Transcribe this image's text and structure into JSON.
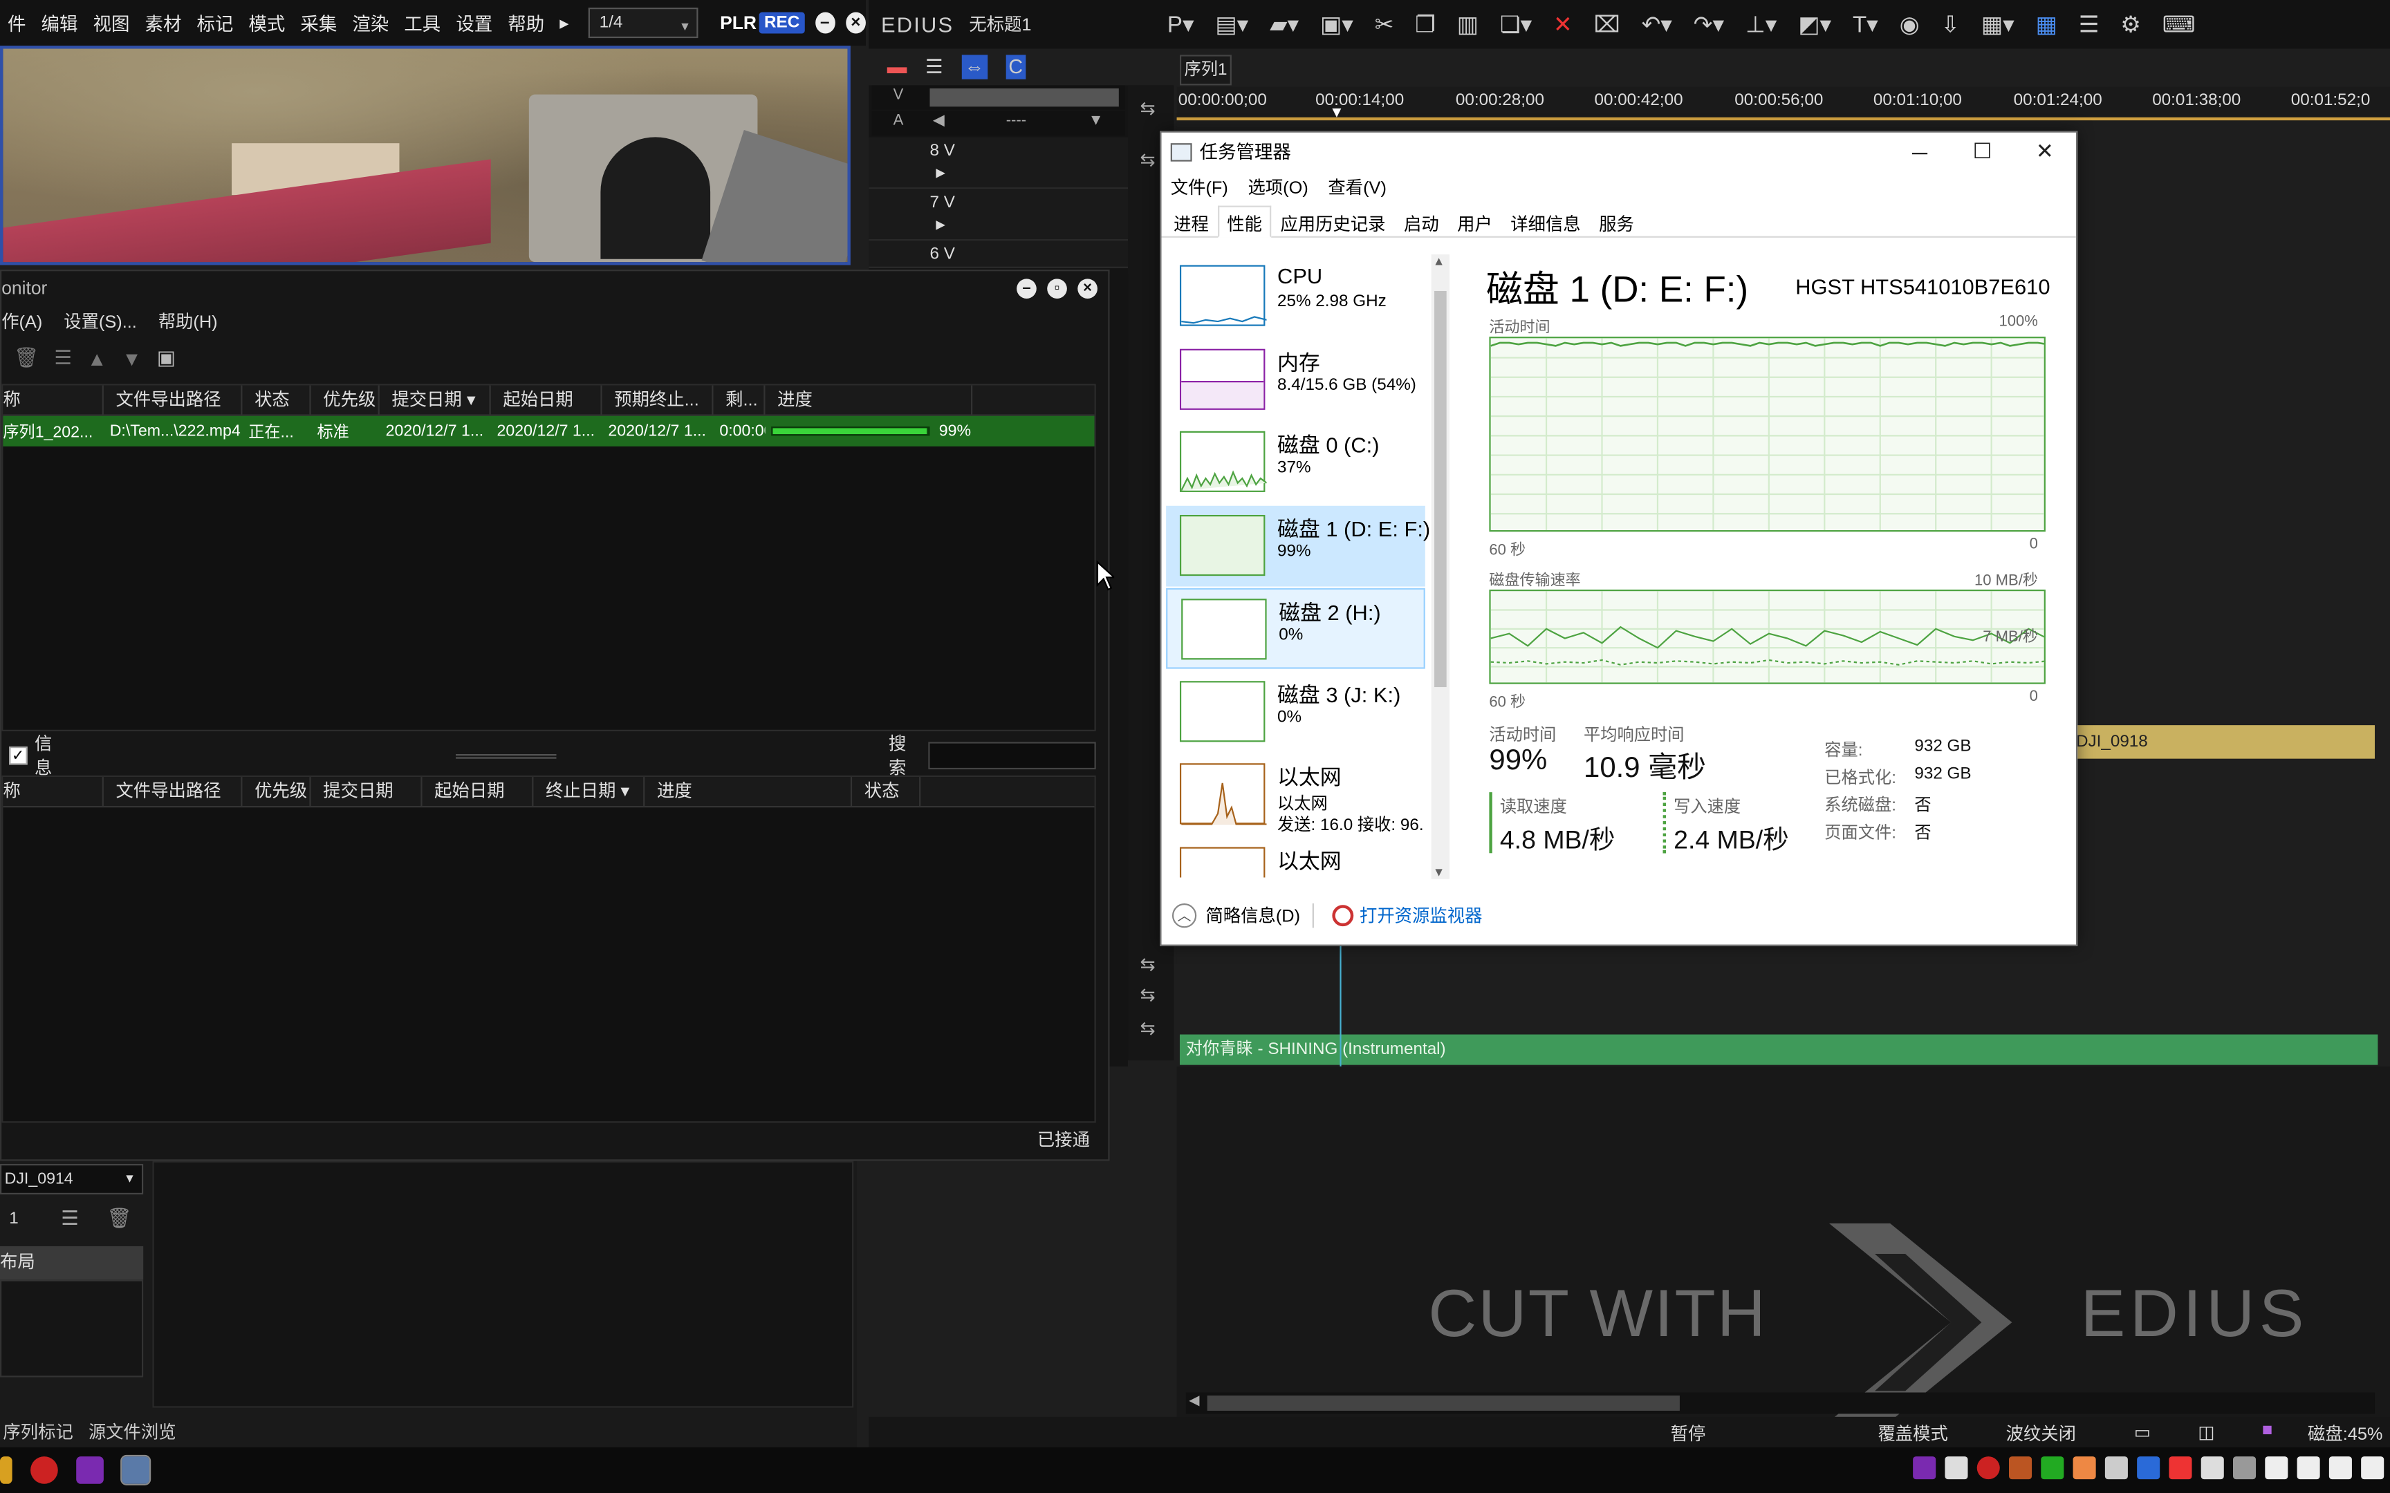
{
  "menubar": {
    "items": [
      "件",
      "编辑",
      "视图",
      "素材",
      "标记",
      "模式",
      "采集",
      "渲染",
      "工具",
      "设置",
      "帮助"
    ],
    "more": "▸",
    "page": "1/4",
    "plr": "PLR",
    "rec": "REC"
  },
  "monitor": {
    "title": "onitor",
    "menu": [
      "作(A)",
      "设置(S)...",
      "帮助(H)"
    ],
    "queue_headers": [
      "称",
      "文件导出路径",
      "状态",
      "优先级",
      "提交日期",
      "起始日期",
      "预期终止...",
      "剩...",
      "进度"
    ],
    "queue_row": {
      "name": "序列1_202...",
      "path": "D:\\Tem...\\222.mp4",
      "status": "正在...",
      "priority": "标准",
      "submit": "2020/12/7 1...",
      "start": "2020/12/7 1...",
      "end": "2020/12/7 1...",
      "remaining": "0:00:00",
      "progress_pct": 99,
      "progress_text": "99%"
    },
    "info_label": "信息",
    "search_label": "搜索",
    "done_headers": [
      "称",
      "文件导出路径",
      "优先级",
      "提交日期",
      "起始日期",
      "终止日期",
      "进度",
      "状态"
    ],
    "status_text": "已接通"
  },
  "edius": {
    "logo": "EDIUS",
    "project": "无标题1",
    "sequence_tab": "序列1",
    "timecodes": [
      "00:00:00;00",
      "00:00:14;00",
      "00:00:28;00",
      "00:00:42;00",
      "00:00:56;00",
      "00:01:10;00",
      "00:01:24;00",
      "00:01:38;00",
      "00:01:52;0"
    ],
    "tracks": [
      "8 V",
      "7 V",
      "6 V"
    ],
    "track_v": "V",
    "track_a": "A",
    "audio_dash": "----",
    "video_clip": "DJI_0918",
    "audio_clip": "对你青睐 - SHINING (Instrumental)",
    "watermark_left": "CUT WITH",
    "watermark_right": "EDIUS",
    "status": {
      "pause": "暂停",
      "overwrite": "覆盖模式",
      "ripple": "波纹关闭",
      "disk": "磁盘:45%"
    }
  },
  "bin": {
    "clip": "DJI_0914",
    "count": "1",
    "layout": "布局",
    "tabs": [
      "序列标记",
      "源文件浏览"
    ]
  },
  "taskmgr": {
    "title": "任务管理器",
    "menu": [
      "文件(F)",
      "选项(O)",
      "查看(V)"
    ],
    "tabs": [
      "进程",
      "性能",
      "应用历史记录",
      "启动",
      "用户",
      "详细信息",
      "服务"
    ],
    "active_tab": "性能",
    "side": [
      {
        "name": "CPU",
        "sub": "25% 2.98 GHz",
        "color": "#1779ba"
      },
      {
        "name": "内存",
        "sub": "8.4/15.6 GB (54%)",
        "color": "#8b22a6"
      },
      {
        "name": "磁盘 0 (C:)",
        "sub": "37%",
        "color": "#4da341"
      },
      {
        "name": "磁盘 1 (D: E: F:)",
        "sub": "99%",
        "color": "#4da341"
      },
      {
        "name": "磁盘 2 (H:)",
        "sub": "0%",
        "color": "#4da341"
      },
      {
        "name": "磁盘 3 (J: K:)",
        "sub": "0%",
        "color": "#4da341"
      },
      {
        "name": "以太网",
        "sub": "以太网",
        "sub2": "发送: 16.0  接收: 96.",
        "color": "#a7621b"
      },
      {
        "name": "以太网",
        "sub": "",
        "color": "#a7621b"
      }
    ],
    "disk_title": "磁盘 1 (D: E: F:)",
    "disk_model": "HGST HTS541010B7E610",
    "chart1": {
      "label": "活动时间",
      "max": "100%",
      "xleft": "60 秒",
      "xright": "0"
    },
    "chart2": {
      "label": "磁盘传输速率",
      "max": "10 MB/秒",
      "mid": "7 MB/秒",
      "xleft": "60 秒",
      "xright": "0"
    },
    "stats": {
      "active_label": "活动时间",
      "active_value": "99%",
      "resp_label": "平均响应时间",
      "resp_value": "10.9 毫秒",
      "read_label": "读取速度",
      "read_value": "4.8 MB/秒",
      "write_label": "写入速度",
      "write_value": "2.4 MB/秒"
    },
    "kv": [
      {
        "k": "容量:",
        "v": "932 GB"
      },
      {
        "k": "已格式化:",
        "v": "932 GB"
      },
      {
        "k": "系统磁盘:",
        "v": "否"
      },
      {
        "k": "页面文件:",
        "v": "否"
      }
    ],
    "footer_brief": "简略信息(D)",
    "footer_link": "打开资源监视器",
    "accent_green": "#4da341"
  }
}
